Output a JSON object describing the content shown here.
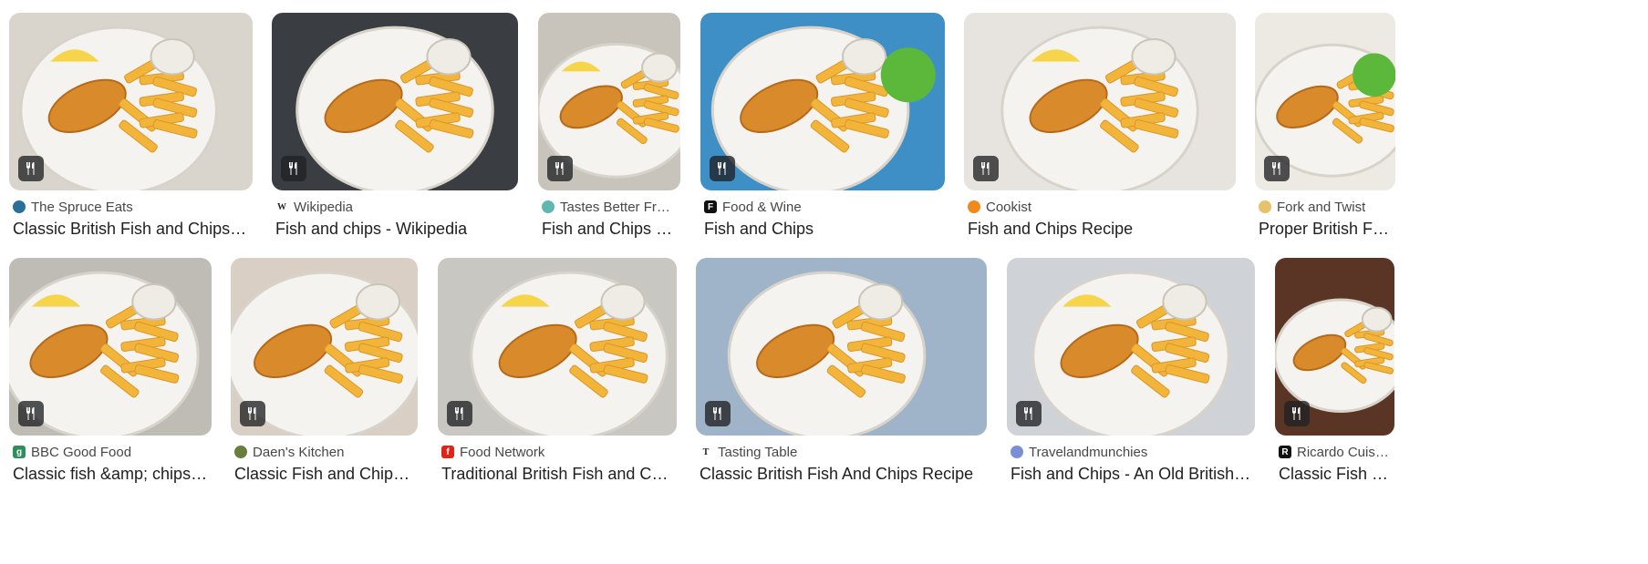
{
  "results": [
    {
      "source": "The Spruce Eats",
      "title": "Classic British Fish and Chips Reci...",
      "favicon_icon": "utensils-favicon-icon",
      "favicon_color": "#2a6f97",
      "bg_color": "#d9d4cc"
    },
    {
      "source": "Wikipedia",
      "title": "Fish and chips - Wikipedia",
      "favicon_icon": "wikipedia-favicon-icon",
      "favicon_color": "#ffffff",
      "favicon_glyph": "W",
      "bg_color": "#3a3d42"
    },
    {
      "source": "Tastes Better From ...",
      "title": "Fish and Chips - T...",
      "favicon_icon": "heart-favicon-icon",
      "favicon_color": "#5fb7b0",
      "bg_color": "#c8c3bb"
    },
    {
      "source": "Food & Wine",
      "title": "Fish and Chips",
      "favicon_icon": "food-wine-favicon-icon",
      "favicon_color": "#111111",
      "favicon_glyph": "F",
      "bg_color": "#3f8fc7"
    },
    {
      "source": "Cookist",
      "title": "Fish and Chips Recipe",
      "favicon_icon": "cookist-favicon-icon",
      "favicon_color": "#f08a1c",
      "bg_color": "#e7e4df"
    },
    {
      "source": "Fork and Twist",
      "title": "Proper British Fish an...",
      "favicon_icon": "fork-twist-favicon-icon",
      "favicon_color": "#e6c26b",
      "bg_color": "#ede9e3"
    },
    {
      "source": "BBC Good Food",
      "title": "Classic fish &amp; chips rec...",
      "favicon_icon": "bbc-good-food-favicon-icon",
      "favicon_color": "#2f8f5b",
      "favicon_glyph": "g",
      "bg_color": "#bfbcb6"
    },
    {
      "source": "Daen's Kitchen",
      "title": "Classic Fish and Chips wi...",
      "favicon_icon": "daens-kitchen-favicon-icon",
      "favicon_color": "#6b7d3a",
      "bg_color": "#d9cfc4"
    },
    {
      "source": "Food Network",
      "title": "Traditional British Fish and Chips ...",
      "favicon_icon": "food-network-favicon-icon",
      "favicon_color": "#e2231a",
      "favicon_glyph": "f",
      "bg_color": "#c9c7c2"
    },
    {
      "source": "Tasting Table",
      "title": "Classic British Fish And Chips Recipe",
      "favicon_icon": "tasting-table-favicon-icon",
      "favicon_color": "#ffffff",
      "favicon_glyph": "T",
      "bg_color": "#9fb3c9"
    },
    {
      "source": "Travelandmunchies",
      "title": "Fish and Chips - An Old British Cla...",
      "favicon_icon": "globe-favicon-icon",
      "favicon_color": "#7a8fd6",
      "bg_color": "#cfd2d6"
    },
    {
      "source": "Ricardo Cuisine",
      "title": "Classic Fish and C...",
      "favicon_icon": "ricardo-favicon-icon",
      "favicon_color": "#111111",
      "favicon_glyph": "R",
      "bg_color": "#5a3526"
    }
  ],
  "badge_icon": "recipe-utensils-icon",
  "colors": {
    "fish": "#d98a2b",
    "fries": "#f2b53a",
    "plate": "#f5f3ef",
    "sauce": "#eeece4",
    "peas": "#5cb83a",
    "lemon": "#f7d54a"
  }
}
